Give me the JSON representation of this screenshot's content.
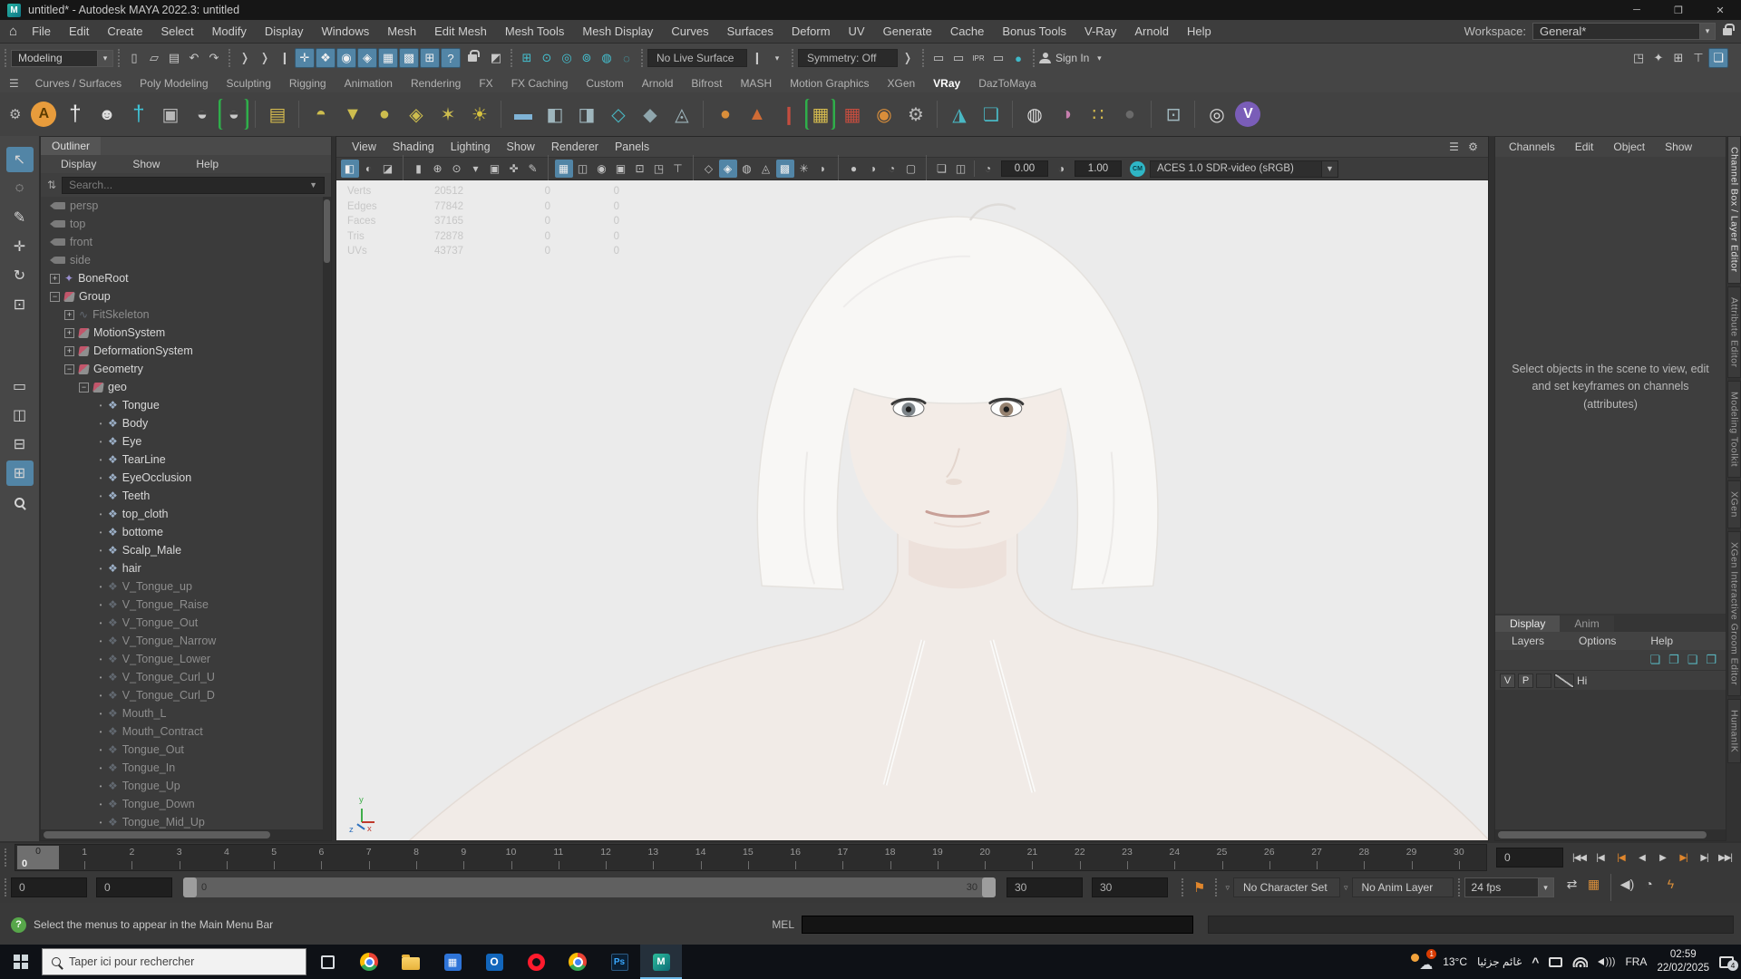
{
  "window": {
    "app_icon": "M",
    "title": "untitled* - Autodesk MAYA 2022.3: untitled",
    "min_glyph": "─",
    "max_glyph": "❐",
    "close_glyph": "✕"
  },
  "menu_bar": {
    "home_icon": "⌂",
    "items": [
      "File",
      "Edit",
      "Create",
      "Select",
      "Modify",
      "Display",
      "Windows",
      "Mesh",
      "Edit Mesh",
      "Mesh Tools",
      "Mesh Display",
      "Curves",
      "Surfaces",
      "Deform",
      "UV",
      "Generate",
      "Cache",
      "Bonus Tools",
      "V-Ray",
      "Arnold",
      "Help"
    ],
    "workspace_label": "Workspace:",
    "workspace_value": "General*"
  },
  "status_line": {
    "mode": "Modeling",
    "file_icons": [
      {
        "n": "new-scene-icon",
        "g": "▯"
      },
      {
        "n": "open-scene-icon",
        "g": "▱"
      },
      {
        "n": "save-scene-icon",
        "g": "▤"
      },
      {
        "n": "undo-icon",
        "g": "↶"
      },
      {
        "n": "redo-icon",
        "g": "↷"
      }
    ],
    "arrow_icons": [
      {
        "n": "selection-arrow-icon",
        "g": "❭"
      },
      {
        "n": "selection-arrow2-icon",
        "g": "❭"
      },
      {
        "n": "pick-divider-icon",
        "g": "❙"
      }
    ],
    "mask_icons": [
      {
        "n": "select-hierarchy-icon",
        "g": "✛",
        "hl": true
      },
      {
        "n": "select-object-icon",
        "g": "❖",
        "hl": true
      },
      {
        "n": "select-component-icon",
        "g": "◉",
        "hl": true
      },
      {
        "n": "select-mesh-icon",
        "g": "◈",
        "hl": true
      },
      {
        "n": "select-grid-icon",
        "g": "▦",
        "hl": true
      },
      {
        "n": "select-curve-icon",
        "g": "▩",
        "hl": true
      },
      {
        "n": "select-surface-icon",
        "g": "⊞",
        "hl": true
      },
      {
        "n": "select-misc-icon",
        "g": "?",
        "hl": true
      }
    ],
    "highlight_icon": {
      "n": "highlight-selection-icon",
      "g": "◩"
    },
    "snap_icons": [
      {
        "n": "snap-grid-icon",
        "g": "⊞"
      },
      {
        "n": "snap-curve-icon",
        "g": "⊙"
      },
      {
        "n": "snap-point-icon",
        "g": "◎"
      },
      {
        "n": "snap-projected-center-icon",
        "g": "⊚"
      },
      {
        "n": "snap-view-plane-icon",
        "g": "◍"
      },
      {
        "n": "make-live-icon",
        "g": "◌"
      }
    ],
    "no_live_surface": "No Live Surface",
    "symmetry": "Symmetry: Off",
    "render_icons": [
      {
        "n": "render-current-frame-icon",
        "g": "▭"
      },
      {
        "n": "render-region-icon",
        "g": "▭"
      },
      {
        "n": "ipr-render-icon",
        "g": "IPR"
      },
      {
        "n": "render-settings-icon",
        "g": "▭"
      },
      {
        "n": "display-ball-icon",
        "g": "●",
        "c": "#3fb9c9"
      }
    ],
    "sign_in": "Sign In",
    "right_icons": [
      {
        "n": "object-details-icon",
        "g": "◳"
      },
      {
        "n": "pose-editor-icon",
        "g": "✦"
      },
      {
        "n": "grid-layout-icon",
        "g": "⊞"
      },
      {
        "n": "construction-history-icon",
        "g": "⊤"
      },
      {
        "n": "panel-overlay-icon",
        "g": "❏",
        "hl": true
      }
    ]
  },
  "shelf": {
    "tabs": [
      "Curves / Surfaces",
      "Poly Modeling",
      "Sculpting",
      "Rigging",
      "Animation",
      "Rendering",
      "FX",
      "FX Caching",
      "Custom",
      "Arnold",
      "Bifrost",
      "MASH",
      "Motion Graphics",
      "XGen",
      "VRay",
      "DazToMaya"
    ],
    "active_tab": "VRay",
    "icons": [
      {
        "n": "vray-a-icon",
        "g": "A",
        "kind": "circ",
        "bg": "#e89c3c",
        "c": "#5d3c00"
      },
      {
        "n": "daz-figure-icon",
        "g": "†",
        "c": "#e9e9e9",
        "fs": 24
      },
      {
        "n": "face-mask-icon",
        "g": "☻",
        "c": "#dcdcdc",
        "fs": 18
      },
      {
        "n": "cyan-figure-icon",
        "g": "†",
        "c": "#3fc3d6",
        "fs": 24
      },
      {
        "n": "asset-window-icon",
        "g": "▣",
        "c": "#b8b8b8"
      },
      {
        "n": "swirl-icon",
        "g": "◒",
        "c": "#c9c9c9"
      },
      {
        "n": "swirl-bracket-icon",
        "g": "◒",
        "c": "#c9c9c9",
        "brk": true
      },
      {
        "sep": true
      },
      {
        "n": "light-lister-icon",
        "g": "▤",
        "c": "#d3b94e"
      },
      {
        "sep": true
      },
      {
        "n": "dome-light-icon",
        "g": "◓",
        "c": "#cdbd4e"
      },
      {
        "n": "rect-light-icon",
        "g": "▼",
        "c": "#cdbd4e"
      },
      {
        "n": "sphere-light-icon",
        "g": "●",
        "c": "#cdbd4e"
      },
      {
        "n": "mesh-light-icon",
        "g": "◈",
        "c": "#cdbd4e"
      },
      {
        "n": "ies-light-icon",
        "g": "✶",
        "c": "#cdbd4e"
      },
      {
        "n": "sun-light-icon",
        "g": "☀",
        "c": "#d6c23f"
      },
      {
        "sep": true
      },
      {
        "n": "infinite-plane-icon",
        "g": "▬",
        "c": "#7fb3d6"
      },
      {
        "n": "proxy-mesh-icon",
        "g": "◧",
        "c": "#9fb6bd"
      },
      {
        "n": "proxy-export-icon",
        "g": "◨",
        "c": "#9fb6bd"
      },
      {
        "n": "scene-import-icon",
        "g": "◇",
        "c": "#49b8c4"
      },
      {
        "n": "vray-material-icon",
        "g": "◆",
        "c": "#8fa6ad"
      },
      {
        "n": "displacement-icon",
        "g": "◬",
        "c": "#9fb6bd"
      },
      {
        "sep": true
      },
      {
        "n": "fur-ball-icon",
        "g": "●",
        "c": "#d98e3a"
      },
      {
        "n": "scatter-icon",
        "g": "▲",
        "c": "#cf6b35"
      },
      {
        "n": "hair-brush-icon",
        "g": "❙",
        "c": "#c44d3f"
      },
      {
        "n": "hair-grid-icon",
        "g": "▦",
        "c": "#d3b94e",
        "brk": true
      },
      {
        "n": "fur-grid-icon",
        "g": "▦",
        "c": "#c44d3f"
      },
      {
        "n": "orange-sphere-icon",
        "g": "◉",
        "c": "#d98e3a"
      },
      {
        "n": "vray-settings-icon",
        "g": "⚙",
        "c": "#b8b8b8"
      },
      {
        "sep": true
      },
      {
        "n": "clipper-icon",
        "g": "◮",
        "c": "#49b8c4"
      },
      {
        "n": "object-properties-icon",
        "g": "❏",
        "c": "#49b8c4"
      },
      {
        "sep": true
      },
      {
        "n": "white-sphere-icon",
        "g": "◍",
        "c": "#dcdcdc"
      },
      {
        "n": "toon-shader-icon",
        "g": "◑",
        "c": "#c77fae"
      },
      {
        "n": "color-swatches-icon",
        "g": "∷",
        "c": "#d3b94e"
      },
      {
        "n": "dark-sphere-icon",
        "g": "●",
        "c": "#6a6a6a"
      },
      {
        "sep": true
      },
      {
        "n": "render-frame-icon",
        "g": "⊡",
        "c": "#9fb6bd"
      },
      {
        "sep": true
      },
      {
        "n": "sphere-ring-icon",
        "g": "◎",
        "c": "#dcdcdc"
      },
      {
        "n": "vray-v-icon",
        "g": "V",
        "kind": "circ",
        "bg": "#7a5db8",
        "c": "#ffffff"
      }
    ]
  },
  "toolbox": {
    "tools": [
      {
        "n": "select-tool",
        "g": "↖",
        "active": true
      },
      {
        "n": "lasso-tool",
        "g": "◌"
      },
      {
        "n": "paint-select-tool",
        "g": "✎"
      },
      {
        "n": "move-tool",
        "g": "✛"
      },
      {
        "n": "rotate-tool",
        "g": "↻"
      },
      {
        "n": "scale-tool",
        "g": "⊡"
      }
    ],
    "layouts": [
      {
        "n": "single-pane-layout",
        "g": "▭"
      },
      {
        "n": "two-pane-layout",
        "g": "◫"
      },
      {
        "n": "split-pane-layout",
        "g": "⊟"
      },
      {
        "n": "four-pane-layout",
        "g": "⊞",
        "active": true
      },
      {
        "n": "zoom-layout-tool",
        "g": "",
        "mag": true
      }
    ]
  },
  "outliner": {
    "tab": "Outliner",
    "menus": [
      "Display",
      "Show",
      "Help"
    ],
    "filter_icon": "⇅",
    "search_placeholder": "Search...",
    "items": [
      {
        "label": "persp",
        "icon": "camera",
        "depth": 0,
        "dim": true
      },
      {
        "label": "top",
        "icon": "camera",
        "depth": 0,
        "dim": true
      },
      {
        "label": "front",
        "icon": "camera",
        "depth": 0,
        "dim": true
      },
      {
        "label": "side",
        "icon": "camera",
        "depth": 0,
        "dim": true
      },
      {
        "label": "BoneRoot",
        "icon": "joint",
        "depth": 0,
        "expand": "+"
      },
      {
        "label": "Group",
        "icon": "transform",
        "depth": 0,
        "expand": "-"
      },
      {
        "label": "FitSkeleton",
        "icon": "curve",
        "depth": 1,
        "expand": "+",
        "dim": true
      },
      {
        "label": "MotionSystem",
        "icon": "transform",
        "depth": 1,
        "expand": "+"
      },
      {
        "label": "DeformationSystem",
        "icon": "transform",
        "depth": 1,
        "expand": "+"
      },
      {
        "label": "Geometry",
        "icon": "transform",
        "depth": 1,
        "expand": "-"
      },
      {
        "label": "geo",
        "icon": "transform",
        "depth": 2,
        "expand": "-"
      },
      {
        "label": "Tongue",
        "icon": "mesh",
        "depth": 3
      },
      {
        "label": "Body",
        "icon": "mesh",
        "depth": 3
      },
      {
        "label": "Eye",
        "icon": "mesh",
        "depth": 3
      },
      {
        "label": "TearLine",
        "icon": "mesh",
        "depth": 3
      },
      {
        "label": "EyeOcclusion",
        "icon": "mesh",
        "depth": 3
      },
      {
        "label": "Teeth",
        "icon": "mesh",
        "depth": 3
      },
      {
        "label": "top_cloth",
        "icon": "mesh",
        "depth": 3
      },
      {
        "label": "bottome",
        "icon": "mesh",
        "depth": 3
      },
      {
        "label": "Scalp_Male",
        "icon": "mesh",
        "depth": 3
      },
      {
        "label": "hair",
        "icon": "mesh",
        "depth": 3
      },
      {
        "label": "V_Tongue_up",
        "icon": "mesh",
        "depth": 3,
        "dim": true
      },
      {
        "label": "V_Tongue_Raise",
        "icon": "mesh",
        "depth": 3,
        "dim": true
      },
      {
        "label": "V_Tongue_Out",
        "icon": "mesh",
        "depth": 3,
        "dim": true
      },
      {
        "label": "V_Tongue_Narrow",
        "icon": "mesh",
        "depth": 3,
        "dim": true
      },
      {
        "label": "V_Tongue_Lower",
        "icon": "mesh",
        "depth": 3,
        "dim": true
      },
      {
        "label": "V_Tongue_Curl_U",
        "icon": "mesh",
        "depth": 3,
        "dim": true
      },
      {
        "label": "V_Tongue_Curl_D",
        "icon": "mesh",
        "depth": 3,
        "dim": true
      },
      {
        "label": "Mouth_L",
        "icon": "mesh",
        "depth": 3,
        "dim": true
      },
      {
        "label": "Mouth_Contract",
        "icon": "mesh",
        "depth": 3,
        "dim": true
      },
      {
        "label": "Tongue_Out",
        "icon": "mesh",
        "depth": 3,
        "dim": true
      },
      {
        "label": "Tongue_In",
        "icon": "mesh",
        "depth": 3,
        "dim": true
      },
      {
        "label": "Tongue_Up",
        "icon": "mesh",
        "depth": 3,
        "dim": true
      },
      {
        "label": "Tongue_Down",
        "icon": "mesh",
        "depth": 3,
        "dim": true
      },
      {
        "label": "Tongue_Mid_Up",
        "icon": "mesh",
        "depth": 3,
        "dim": true
      }
    ]
  },
  "viewport": {
    "menus": [
      "View",
      "Shading",
      "Lighting",
      "Show",
      "Renderer",
      "Panels"
    ],
    "menu_right_icons": [
      {
        "n": "panel-menu-icon",
        "g": "☰"
      },
      {
        "n": "panel-gear-icon",
        "g": "⚙"
      }
    ],
    "toolbar_icons": [
      {
        "n": "renderer-toggle-icon",
        "g": "◧",
        "hl": true
      },
      {
        "n": "lighting-toggle-icon",
        "g": "◐"
      },
      {
        "n": "shadow-toggle-icon",
        "g": "◪"
      },
      {
        "sep": true
      },
      {
        "n": "camera-select-icon",
        "g": "▮"
      },
      {
        "n": "camera-lock-icon",
        "g": "⊕"
      },
      {
        "n": "camera-attributes-icon",
        "g": "⊙"
      },
      {
        "n": "bookmark-icon",
        "g": "▾"
      },
      {
        "n": "image-plane-icon",
        "g": "▣"
      },
      {
        "n": "pan-zoom-icon",
        "g": "✜"
      },
      {
        "n": "grease-pencil-icon",
        "g": "✎"
      },
      {
        "sep": true
      },
      {
        "n": "grid-toggle-icon",
        "g": "▦",
        "hl": true
      },
      {
        "n": "film-gate-icon",
        "g": "◫"
      },
      {
        "n": "resolution-gate-icon",
        "g": "◉"
      },
      {
        "n": "gate-mask-icon",
        "g": "▣"
      },
      {
        "n": "field-chart-icon",
        "g": "⊡"
      },
      {
        "n": "safe-action-icon",
        "g": "◳"
      },
      {
        "n": "safe-title-icon",
        "g": "⊤"
      },
      {
        "sep": true
      },
      {
        "n": "wireframe-icon",
        "g": "◇"
      },
      {
        "n": "shaded-mode-icon",
        "g": "◈",
        "hl": true
      },
      {
        "n": "textured-mode-icon",
        "g": "◍"
      },
      {
        "n": "use-all-lights-icon",
        "g": "◬"
      },
      {
        "n": "shadows-icon",
        "g": "▩",
        "hl": true
      },
      {
        "n": "ambient-occlusion-icon",
        "g": "✳"
      },
      {
        "n": "motion-blur-icon",
        "g": "◗"
      },
      {
        "sep": true
      },
      {
        "n": "multisample-icon",
        "g": "●"
      },
      {
        "n": "depth-peeling-icon",
        "g": "◑"
      },
      {
        "n": "exposure-toggle-icon",
        "g": "◔"
      },
      {
        "n": "gamma-toggle-icon",
        "g": "▢"
      },
      {
        "sep": true
      },
      {
        "n": "xray-icon",
        "g": "❏"
      },
      {
        "n": "isolate-select-icon",
        "g": "◫"
      }
    ],
    "exposure": "0.00",
    "gamma": "1.00",
    "color_management_icon": "CM",
    "colorspace": "ACES 1.0 SDR-video (sRGB)",
    "hud_rows": [
      [
        "Verts",
        "20512",
        "0",
        "0"
      ],
      [
        "Edges",
        "77842",
        "0",
        "0"
      ],
      [
        "Faces",
        "37165",
        "0",
        "0"
      ],
      [
        "Tris",
        "72878",
        "0",
        "0"
      ],
      [
        "UVs",
        "43737",
        "0",
        "0"
      ]
    ],
    "axis": {
      "y": "y",
      "x": "x",
      "z": "z"
    }
  },
  "channel_box": {
    "menus": [
      "Channels",
      "Edit",
      "Object",
      "Show"
    ],
    "message": "Select objects in the scene to view, edit and set keyframes on channels (attributes)",
    "tabs": [
      {
        "label": "Display",
        "active": true
      },
      {
        "label": "Anim"
      }
    ],
    "layer_menus": [
      "Layers",
      "Options",
      "Help"
    ],
    "layer_icons": [
      {
        "n": "move-layer-up-icon",
        "g": "❏"
      },
      {
        "n": "move-layer-down-icon",
        "g": "❐"
      },
      {
        "n": "empty-layer-icon",
        "g": "❑"
      },
      {
        "n": "new-layer-icon",
        "g": "❒"
      }
    ],
    "layer_row": {
      "v": "V",
      "p": "P",
      "name": "Hi"
    }
  },
  "side_tabs": [
    {
      "label": "Channel Box / Layer Editor",
      "active": true
    },
    {
      "label": "Attribute Editor"
    },
    {
      "label": "Modeling Toolkit"
    },
    {
      "label": "XGen"
    },
    {
      "label": "XGen Interactive Groom Editor"
    },
    {
      "label": "HumanIK"
    }
  ],
  "time_slider": {
    "start": 0,
    "end": 30,
    "current": "0",
    "current_field": "0",
    "playback": [
      {
        "n": "go-to-start-button",
        "g": "|◀◀"
      },
      {
        "n": "step-back-frame-button",
        "g": "|◀"
      },
      {
        "n": "step-back-key-button",
        "g": "|◀",
        "orange": true
      },
      {
        "n": "play-backwards-button",
        "g": "◀"
      },
      {
        "n": "play-forwards-button",
        "g": "▶"
      },
      {
        "n": "step-forward-key-button",
        "g": "▶|",
        "orange": true
      },
      {
        "n": "step-forward-frame-button",
        "g": "▶|"
      },
      {
        "n": "go-to-end-button",
        "g": "▶▶|"
      }
    ]
  },
  "range_slider": {
    "anim_start": "0",
    "range_start": "0",
    "bar_start_label": "0",
    "bar_end_label": "30",
    "range_end": "30",
    "anim_end": "30",
    "character_set": "No Character Set",
    "anim_layer": "No Anim Layer",
    "fps": "24 fps",
    "icons": [
      {
        "n": "loop-playback-icon",
        "g": "⇄"
      },
      {
        "n": "playblast-icon",
        "g": "▦",
        "c": "#d98e3a"
      },
      {
        "sep": true
      },
      {
        "n": "mute-sounds-icon",
        "g": "◀)"
      },
      {
        "n": "animation-prefs-icon",
        "g": "◔"
      },
      {
        "n": "evaluation-mode-icon",
        "g": "ϟ",
        "c": "#d98e3a"
      }
    ]
  },
  "bottom_bar": {
    "help_icon": "?",
    "help_text": "Select the menus to appear in the Main Menu Bar",
    "mel_label": "MEL"
  },
  "taskbar": {
    "search_placeholder": "Taper ici pour rechercher",
    "apps": [
      {
        "n": "chrome-icon",
        "kind": "chrome"
      },
      {
        "n": "file-explorer-icon",
        "kind": "folder"
      },
      {
        "n": "blue-app-icon",
        "kind": "blueapp",
        "g": "▦"
      },
      {
        "n": "outlook-icon",
        "kind": "outlook",
        "g": "O"
      },
      {
        "n": "opera-icon",
        "kind": "opera"
      },
      {
        "n": "chrome-profile-icon",
        "kind": "chrome"
      },
      {
        "n": "photoshop-icon",
        "kind": "ps",
        "g": "Ps"
      },
      {
        "n": "maya-icon",
        "kind": "maya",
        "g": "M",
        "active": true
      }
    ],
    "tray": {
      "weather_badge": "1",
      "temp": "13°C",
      "weather": "غائم جزئيا",
      "lang": "FRA",
      "time": "02:59",
      "date": "22/02/2025",
      "notif_badge": "4"
    }
  }
}
